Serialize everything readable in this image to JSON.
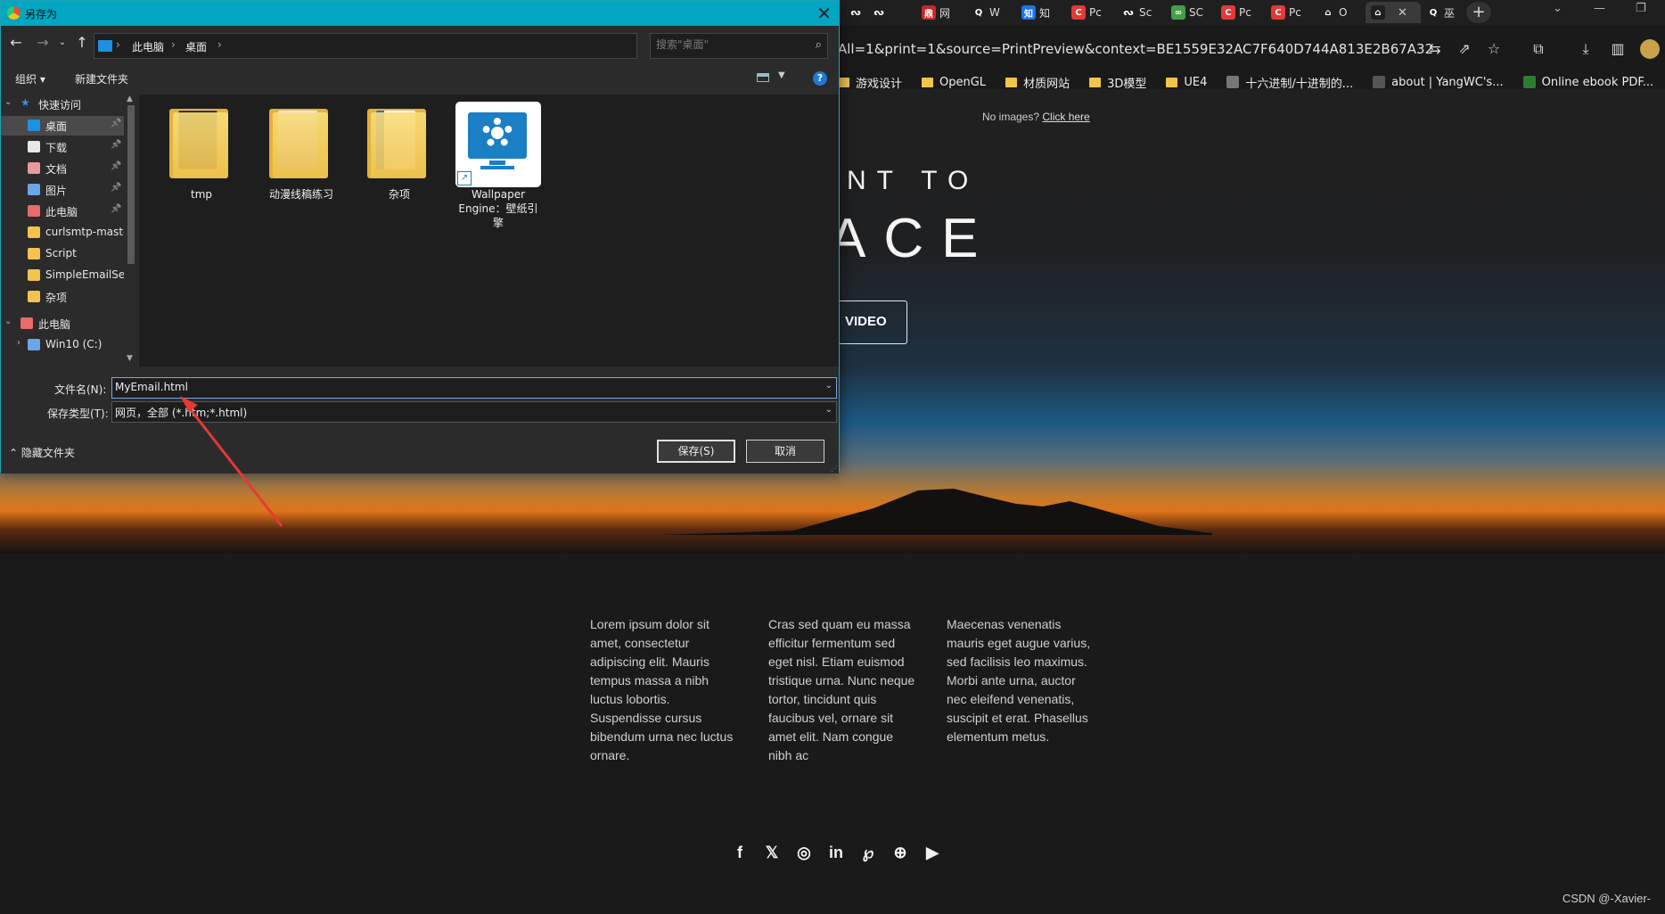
{
  "browser": {
    "tabs": [
      {
        "label": "",
        "icon": "ᔓ",
        "icon_color": "#1f1f1f"
      },
      {
        "label": "",
        "icon": "ᔓ",
        "icon_color": "#1f1f1f"
      },
      {
        "label": "网",
        "icon": "鼎",
        "icon_color": "#c62828"
      },
      {
        "label": "W",
        "icon": "Q",
        "icon_color": "#1f1f1f"
      },
      {
        "label": "知",
        "icon": "知",
        "icon_color": "#1a73e8"
      },
      {
        "label": "Pc",
        "icon": "C",
        "icon_color": "#e53935"
      },
      {
        "label": "Sc",
        "icon": "ᔓ",
        "icon_color": "#1f1f1f"
      },
      {
        "label": "SC",
        "icon": "∞",
        "icon_color": "#43a047"
      },
      {
        "label": "Pc",
        "icon": "C",
        "icon_color": "#e53935"
      },
      {
        "label": "Pc",
        "icon": "C",
        "icon_color": "#e53935"
      },
      {
        "label": "O",
        "icon": "⌂",
        "icon_color": "#1f1f1f"
      },
      {
        "label": "",
        "icon": "⌂",
        "icon_color": "#1f1f1f",
        "active": true
      },
      {
        "label": "巫",
        "icon": "Q",
        "icon_color": "#1f1f1f"
      }
    ],
    "new_tab": "+",
    "address": "All=1&print=1&source=PrintPreview&context=BE1559E32AC7F640D744A813E2B67A32",
    "bookmarks": [
      {
        "label": "游戏设计",
        "type": "folder"
      },
      {
        "label": "OpenGL",
        "type": "folder"
      },
      {
        "label": "材质网站",
        "type": "folder"
      },
      {
        "label": "3D模型",
        "type": "folder"
      },
      {
        "label": "UE4",
        "type": "folder"
      },
      {
        "label": "十六进制/十进制的...",
        "type": "site",
        "color": "#777"
      },
      {
        "label": "about | YangWC's...",
        "type": "site",
        "color": "#555"
      },
      {
        "label": "Online ebook PDF...",
        "type": "site",
        "color": "#2e7d32"
      }
    ],
    "page": {
      "no_images_text": "No images? ",
      "click_here": "Click here",
      "hero_line1": "NT TO",
      "hero_line2": "ACE",
      "video_button": "VIDEO",
      "columns": [
        "Lorem ipsum dolor sit amet, consectetur adipiscing elit. Mauris tempus massa a nibh luctus lobortis. Suspendisse cursus bibendum urna nec luctus ornare.",
        "Cras sed quam eu massa efficitur fermentum sed eget nisl. Etiam euismod tristique urna. Nunc neque tortor, tincidunt quis faucibus vel, ornare sit amet elit. Nam congue nibh ac",
        "Maecenas venenatis mauris eget augue varius, sed facilisis leo maximus. Morbi ante urna, auctor nec eleifend venenatis, suscipit et erat. Phasellus elementum metus."
      ],
      "social": [
        "f",
        "𝕏",
        "◎",
        "in",
        "℘",
        "⊕",
        "▶"
      ]
    },
    "watermark": "CSDN @-Xavier-"
  },
  "dialog": {
    "title": "另存为",
    "path": [
      "此电脑",
      "桌面"
    ],
    "search_placeholder": "搜索\"桌面\"",
    "organize": "组织 ▾",
    "new_folder": "新建文件夹",
    "help": "?",
    "nav": [
      {
        "label": "快速访问",
        "level": 0,
        "expanded": true,
        "icon_color": "#3d8de0",
        "star": true
      },
      {
        "label": "桌面",
        "level": 1,
        "selected": true,
        "icon_color": "#1e90e0",
        "pinned": true
      },
      {
        "label": "下载",
        "level": 1,
        "icon_color": "#e8e8e8",
        "pinned": true
      },
      {
        "label": "文档",
        "level": 1,
        "icon_color": "#e89a9a",
        "pinned": true
      },
      {
        "label": "图片",
        "level": 1,
        "icon_color": "#6aa6e8",
        "pinned": true
      },
      {
        "label": "此电脑",
        "level": 1,
        "icon_color": "#e86a6a",
        "pinned": true
      },
      {
        "label": "curlsmtp-master",
        "level": 1,
        "icon_color": "#f3c34f"
      },
      {
        "label": "Script",
        "level": 1,
        "icon_color": "#f3c34f"
      },
      {
        "label": "SimpleEmailSender",
        "level": 1,
        "icon_color": "#f3c34f"
      },
      {
        "label": "杂项",
        "level": 1,
        "icon_color": "#f3c34f"
      },
      {
        "label": "此电脑",
        "level": 0,
        "expanded": true,
        "icon_color": "#e86a6a"
      },
      {
        "label": "Win10 (C:)",
        "level": 1,
        "collapsed": true,
        "icon_color": "#6aa6e8"
      }
    ],
    "files": [
      {
        "label": "tmp",
        "kind": "folder",
        "page_color": "#111"
      },
      {
        "label": "动漫线稿练习",
        "kind": "folder",
        "page_color": "#e9d6e6"
      },
      {
        "label": "杂项",
        "kind": "folder",
        "page_color": "#2a6fd6"
      },
      {
        "label": "Wallpaper Engine：壁纸引擎",
        "kind": "shortcut"
      }
    ],
    "filename_label": "文件名(N):",
    "filename_value": "MyEmail.html",
    "filetype_label": "保存类型(T):",
    "filetype_value": "网页，全部 (*.htm;*.html)",
    "hide_folders": "隐藏文件夹",
    "save_button": "保存(S)",
    "cancel_button": "取消"
  },
  "colors": {
    "title_bar": "#00a6c2",
    "accent_blue": "#1e78d7",
    "annotation_arrow": "#e53935"
  }
}
